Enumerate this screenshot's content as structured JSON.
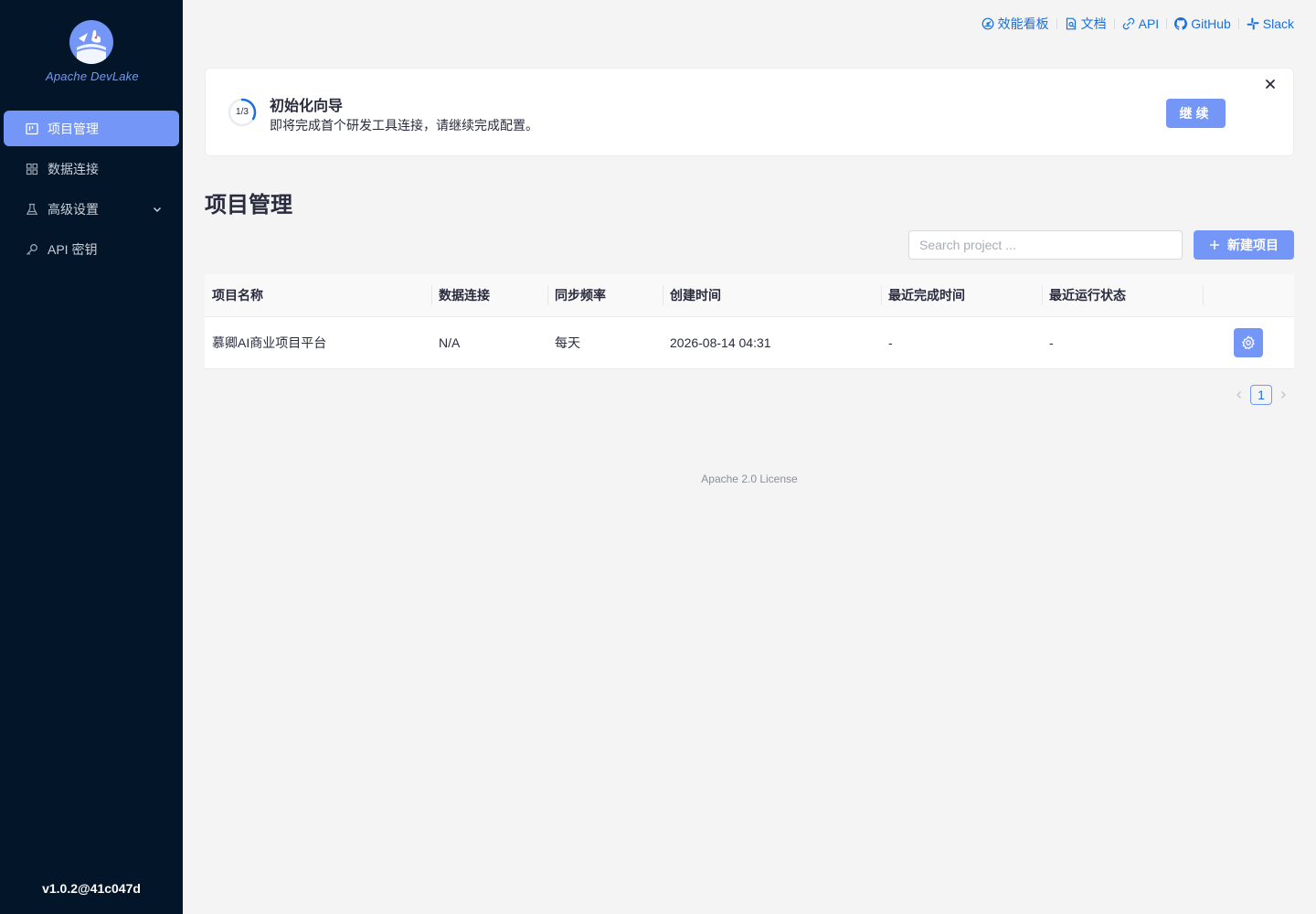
{
  "sidebar": {
    "logo_text": "Apache DevLake",
    "items": [
      {
        "label": "项目管理",
        "icon": "project-icon",
        "active": true
      },
      {
        "label": "数据连接",
        "icon": "grid-icon",
        "active": false
      },
      {
        "label": "高级设置",
        "icon": "flask-icon",
        "active": false
      },
      {
        "label": "API 密钥",
        "icon": "key-icon",
        "active": false
      }
    ],
    "version": "v1.0.2@41c047d"
  },
  "toplinks": [
    {
      "label": "效能看板",
      "icon": "dashboard-icon"
    },
    {
      "label": "文档",
      "icon": "document-icon"
    },
    {
      "label": "API",
      "icon": "api-icon"
    },
    {
      "label": "GitHub",
      "icon": "github-icon"
    },
    {
      "label": "Slack",
      "icon": "slack-icon"
    }
  ],
  "onboarding": {
    "progress_text": "1/3",
    "progress_fraction": 0.333,
    "title": "初始化向导",
    "description": "即将完成首个研发工具连接，请继续完成配置。",
    "continue_label": "继续"
  },
  "page": {
    "title": "项目管理",
    "search_placeholder": "Search project ...",
    "new_button_label": "新建项目"
  },
  "table": {
    "columns": [
      "项目名称",
      "数据连接",
      "同步频率",
      "创建时间",
      "最近完成时间",
      "最近运行状态",
      ""
    ],
    "rows": [
      [
        "慕卿AI商业项目平台",
        "N/A",
        "每天",
        "2026-08-14 04:31",
        "-",
        "-"
      ]
    ]
  },
  "pagination": {
    "current_page": "1"
  },
  "footer": {
    "license": "Apache 2.0 License"
  },
  "colors": {
    "primary": "#7497f7",
    "link": "#1a6fe0",
    "sidebar_bg": "#031629"
  }
}
